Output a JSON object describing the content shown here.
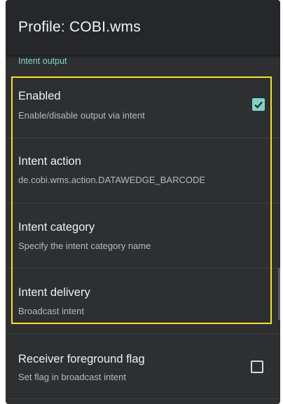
{
  "appbar": {
    "title": "Profile: COBI.wms"
  },
  "section": {
    "header": "Intent output"
  },
  "preferences": [
    {
      "title": "Enabled",
      "summary": "Enable/disable output via intent",
      "checkbox": true,
      "checked": true
    },
    {
      "title": "Intent action",
      "summary": "de.cobi.wms.action.DATAWEDGE_BARCODE",
      "checkbox": false
    },
    {
      "title": "Intent category",
      "summary": "Specify the intent category name",
      "checkbox": false
    },
    {
      "title": "Intent delivery",
      "summary": "Broadcast intent",
      "checkbox": false
    },
    {
      "title": "Receiver foreground flag",
      "summary": "Set flag in broadcast intent",
      "checkbox": true,
      "checked": false
    }
  ],
  "colors": {
    "background": "#2e2f31",
    "appbar": "#26272a",
    "accent": "#7fd3c8",
    "highlight": "#f7e21a"
  },
  "icons": {
    "checkbox_checked": "check-icon"
  }
}
